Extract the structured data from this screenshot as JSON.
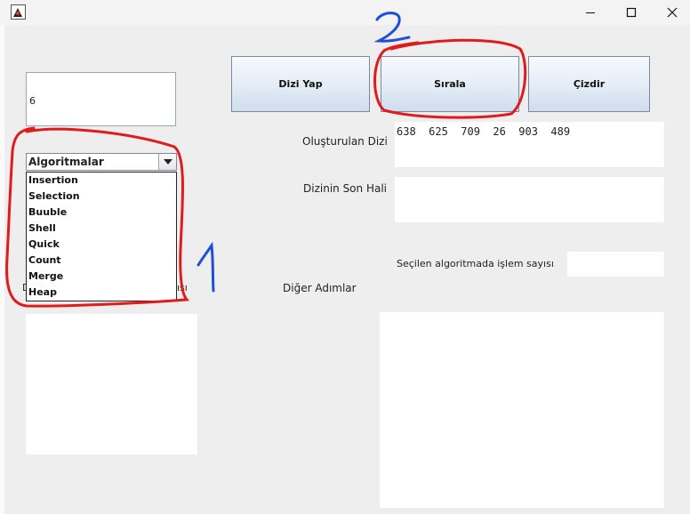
{
  "window": {
    "app_icon": "java-duke-icon",
    "controls": [
      "minimize-icon",
      "maximize-icon",
      "close-icon"
    ]
  },
  "size_input": {
    "value": "6"
  },
  "algorithm_combo": {
    "selected": "Algoritmalar",
    "options": [
      "Insertion",
      "Selection",
      "Buuble",
      "Shell",
      "Quick",
      "Count",
      "Merge",
      "Heap"
    ]
  },
  "buttons": {
    "create": "Dizi Yap",
    "sort": "Sırala",
    "draw": "Çizdir"
  },
  "labels": {
    "created_array": "Oluşturulan Dizi",
    "final_array": "Dizinin Son Hali",
    "op_count": "Seçilen algoritmada işlem sayısı",
    "other_steps": "Diğer Adımlar",
    "partial_left": "D",
    "partial_right": "ısı"
  },
  "fields": {
    "created_array_value": "638  625  709  26  903  489",
    "final_array_value": "",
    "op_count_value": ""
  },
  "annotations": {
    "marker_1": "1",
    "marker_2": "2"
  },
  "colors": {
    "annotation_red": "#e01b1b",
    "annotation_blue": "#1d4fd8",
    "button_border": "#7a8a9c"
  }
}
